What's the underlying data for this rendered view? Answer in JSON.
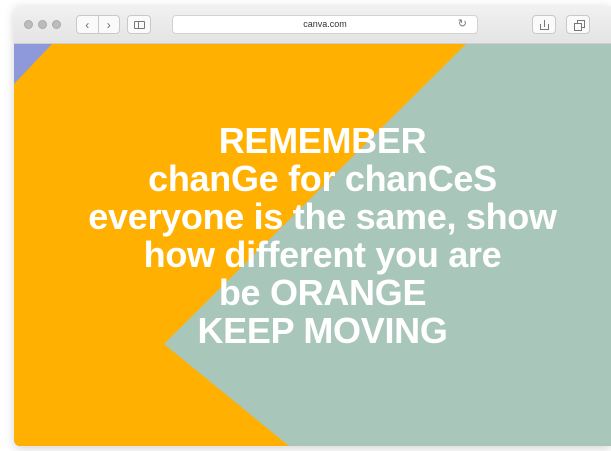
{
  "browser": {
    "url": "canva.com",
    "back_icon": "chevron-left-icon",
    "forward_icon": "chevron-right-icon",
    "reload_icon": "reload-icon"
  },
  "poster": {
    "colors": {
      "orange": "#ffb000",
      "sage": "#a8c6ba",
      "periwinkle": "#8d99da"
    },
    "lines": [
      "REMEMBER",
      "chanGe for chanCeS",
      "everyone is the same, show",
      "how different you are",
      "be ORANGE",
      "KEEP MOVING"
    ]
  }
}
